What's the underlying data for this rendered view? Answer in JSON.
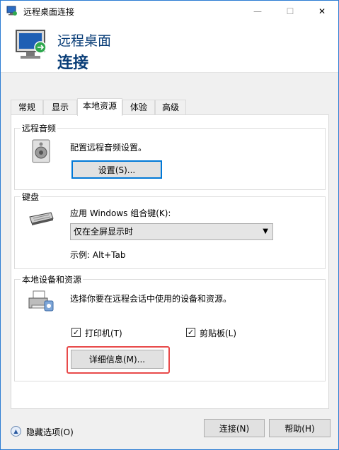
{
  "window": {
    "title": "远程桌面连接",
    "minimize_glyph": "—",
    "maximize_glyph": "☐",
    "close_glyph": "✕"
  },
  "header": {
    "line1": "远程桌面",
    "line2": "连接",
    "icon": "remote-desktop-monitor-icon"
  },
  "tabs": [
    {
      "label": "常规",
      "active": false
    },
    {
      "label": "显示",
      "active": false
    },
    {
      "label": "本地资源",
      "active": true
    },
    {
      "label": "体验",
      "active": false
    },
    {
      "label": "高级",
      "active": false
    }
  ],
  "audio": {
    "group_title": "远程音频",
    "description": "配置远程音频设置。",
    "button_label": "设置(S)...",
    "icon": "speaker-icon"
  },
  "keyboard": {
    "group_title": "键盘",
    "description": "应用 Windows 组合键(K):",
    "selected_option": "仅在全屏显示时",
    "example": "示例: Alt+Tab",
    "icon": "keyboard-icon"
  },
  "devices": {
    "group_title": "本地设备和资源",
    "description": "选择你要在远程会话中使用的设备和资源。",
    "printers_label": "打印机(T)",
    "printers_checked": true,
    "clipboard_label": "剪贴板(L)",
    "clipboard_checked": true,
    "details_button_label": "详细信息(M)...",
    "icon": "printer-devices-icon"
  },
  "footer": {
    "hide_options_label": "隐藏选项(O)",
    "connect_label": "连接(N)",
    "help_label": "帮助(H)"
  },
  "colors": {
    "accent": "#0078d7",
    "header_text": "#0a3e78",
    "highlight_box": "#e84a4a"
  }
}
